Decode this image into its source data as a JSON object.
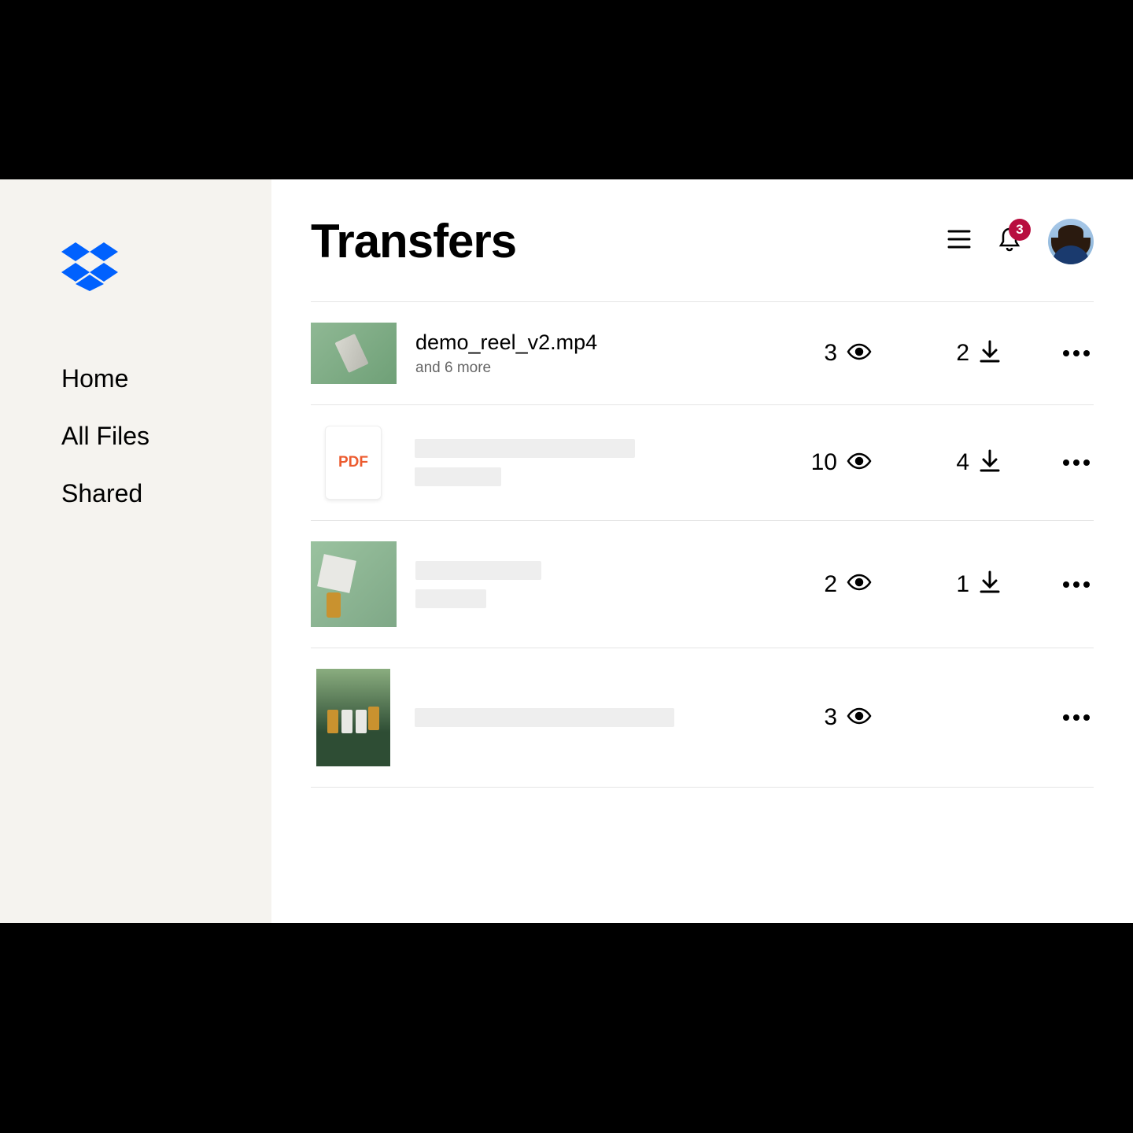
{
  "sidebar": {
    "items": [
      {
        "label": "Home"
      },
      {
        "label": "All Files"
      },
      {
        "label": "Shared"
      }
    ]
  },
  "header": {
    "title": "Transfers",
    "notification_count": "3"
  },
  "transfers": [
    {
      "name": "demo_reel_v2.mp4",
      "meta": "and 6 more",
      "views": "3",
      "downloads": "2",
      "thumb": "green1",
      "has_name": true,
      "has_downloads": true
    },
    {
      "name": "",
      "meta": "",
      "views": "10",
      "downloads": "4",
      "thumb": "pdf",
      "pdf_label": "PDF",
      "has_name": false,
      "has_downloads": true
    },
    {
      "name": "",
      "meta": "",
      "views": "2",
      "downloads": "1",
      "thumb": "green2",
      "has_name": false,
      "has_downloads": true
    },
    {
      "name": "",
      "meta": "",
      "views": "3",
      "downloads": "",
      "thumb": "green3",
      "has_name": false,
      "has_downloads": false
    }
  ]
}
